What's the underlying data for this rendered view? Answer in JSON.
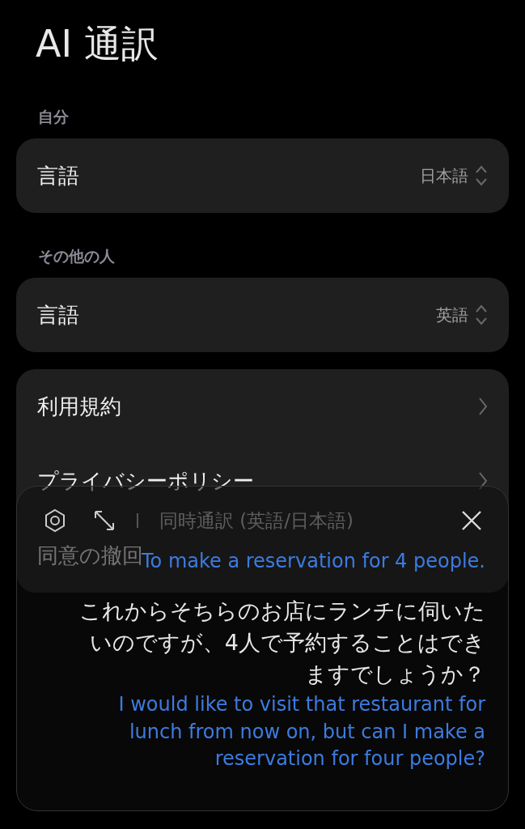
{
  "title": "AI 通訳",
  "sections": [
    {
      "header": "自分",
      "rows": [
        {
          "kind": "select",
          "label": "言語",
          "value": "日本語"
        }
      ]
    },
    {
      "header": "その他の人",
      "rows": [
        {
          "kind": "select",
          "label": "言語",
          "value": "英語"
        }
      ]
    },
    {
      "rows": [
        {
          "kind": "link",
          "label": "利用規約"
        },
        {
          "kind": "link",
          "label": "プライバシーポリシー"
        },
        {
          "kind": "plain",
          "label": "同意の撤回"
        }
      ]
    }
  ],
  "overlay": {
    "mode": "同時通訳 (英語/日本語)",
    "lines": [
      {
        "kind": "translation",
        "text": "To make a reservation for 4 people."
      },
      {
        "kind": "source",
        "text": "これからそちらのお店にランチに伺いたいのですが、4人で予約することはできますでしょうか？"
      },
      {
        "kind": "translation",
        "text": "I would like to visit that restaurant for lunch from now on, but can I make a reservation for four people?"
      }
    ]
  }
}
